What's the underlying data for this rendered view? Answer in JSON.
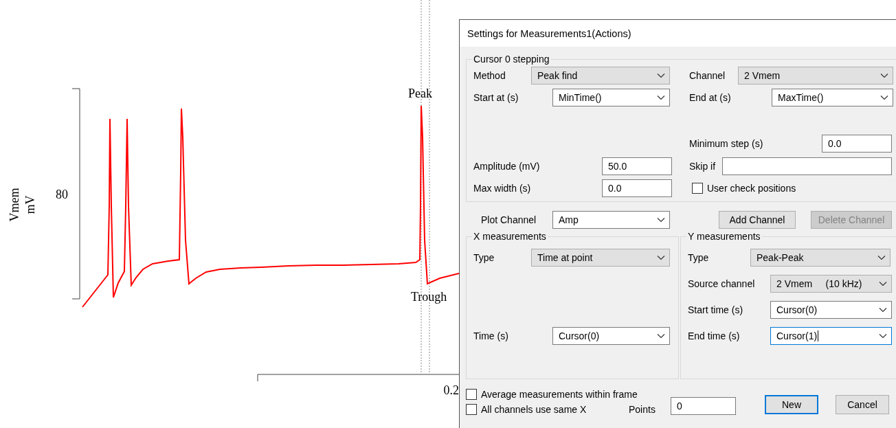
{
  "plot": {
    "y_label": "Vmem",
    "y_unit": "mV",
    "y_scale": "80",
    "x_scale": "0.2",
    "markers": [
      {
        "label": "Peak"
      },
      {
        "label": "Trough"
      }
    ]
  },
  "dialog": {
    "title": "Settings for Measurements1(Actions)",
    "cursor_group": {
      "title": "Cursor 0 stepping",
      "left": [
        {
          "label": "Method",
          "value": "Peak find",
          "kind": "dropdown",
          "focused": false
        },
        {
          "label": "Start at (s)",
          "value": "MinTime()",
          "kind": "combo",
          "focused": false
        },
        {
          "label": "Amplitude (mV)",
          "value": "50.0",
          "kind": "text",
          "focused": false
        },
        {
          "label": "Max width (s)",
          "value": "0.0",
          "kind": "text",
          "focused": false
        }
      ],
      "right": [
        {
          "label": "Channel",
          "value": "2 Vmem",
          "kind": "dropdown",
          "focused": false
        },
        {
          "label": "End at (s)",
          "value": "MaxTime()",
          "kind": "combo",
          "focused": false
        },
        {
          "label": "Minimum step (s)",
          "value": "0.0",
          "kind": "text",
          "focused": false
        },
        {
          "label": "Skip if",
          "kind": "text",
          "focused": false
        },
        {
          "label": "User check positions",
          "kind": "checkbox",
          "checked": false
        }
      ]
    },
    "plot_channel": {
      "label": "Plot Channel",
      "value": "Amp",
      "kind": "combo",
      "focused": false
    },
    "channel_buttons": [
      {
        "label": "Add Channel",
        "disabled": false
      },
      {
        "label": "Delete Channel",
        "disabled": true
      }
    ],
    "x_group": {
      "title": "X measurements",
      "fields": [
        {
          "label": "Type",
          "value": "Time at point",
          "kind": "dropdown",
          "focused": false
        },
        {
          "label": "Time (s)",
          "value": "Cursor(0)",
          "kind": "combo",
          "focused": false
        }
      ]
    },
    "y_group": {
      "title": "Y measurements",
      "fields": [
        {
          "label": "Type",
          "value": "Peak-Peak",
          "kind": "dropdown",
          "focused": false
        },
        {
          "label": "Source channel",
          "value": "2 Vmem     (10 kHz)",
          "kind": "dropdown",
          "focused": false
        },
        {
          "label": "Start time (s)",
          "value": "Cursor(0)",
          "kind": "combo",
          "focused": false
        },
        {
          "label": "End time (s)",
          "value": "Cursor(1)",
          "kind": "combo",
          "focused": true
        }
      ]
    },
    "options": [
      {
        "label": "Average measurements within frame",
        "checked": false
      },
      {
        "label": "All channels use same X",
        "checked": false
      }
    ],
    "points": {
      "label": "Points",
      "value": "0"
    },
    "buttons": [
      {
        "label": "New",
        "default": true
      },
      {
        "label": "Cancel",
        "default": false
      }
    ]
  }
}
